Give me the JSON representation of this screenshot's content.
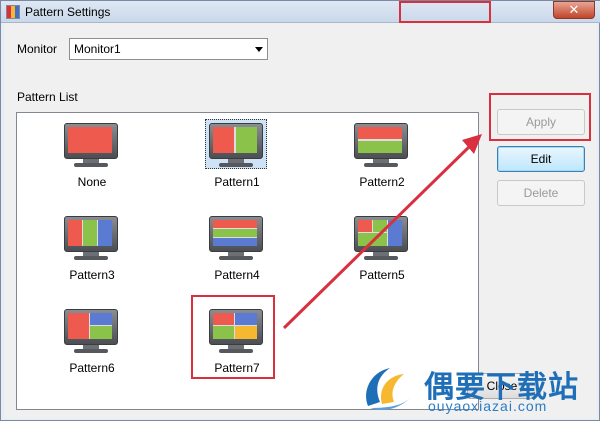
{
  "window": {
    "title": "Pattern Settings",
    "close_glyph": "✕"
  },
  "monitor": {
    "label": "Monitor",
    "selected": "Monitor1"
  },
  "pattern_list": {
    "label": "Pattern List",
    "selected": "Pattern1",
    "items": [
      {
        "name": "None"
      },
      {
        "name": "Pattern1"
      },
      {
        "name": "Pattern2"
      },
      {
        "name": "Pattern3"
      },
      {
        "name": "Pattern4"
      },
      {
        "name": "Pattern5"
      },
      {
        "name": "Pattern6"
      },
      {
        "name": "Pattern7"
      }
    ]
  },
  "buttons": {
    "apply": "Apply",
    "edit": "Edit",
    "delete": "Delete",
    "close": "Close"
  },
  "watermark": {
    "brand": "偶要下载站",
    "url": "ouyaoxiazai.com"
  },
  "colors": {
    "red": "#ee5a4e",
    "green": "#8bc34a",
    "blue": "#5a7bd1",
    "yellow": "#f5b82e",
    "annotation": "#d93040"
  }
}
